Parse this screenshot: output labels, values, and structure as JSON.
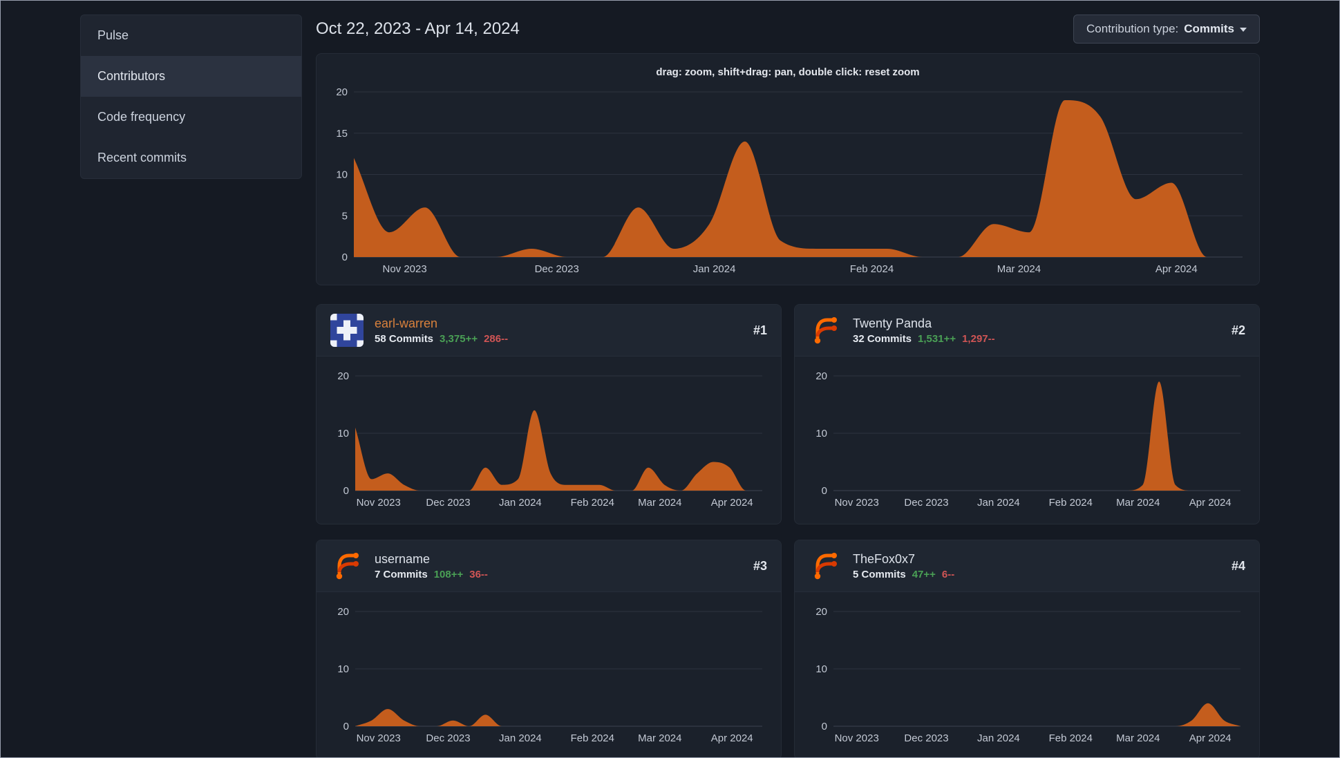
{
  "colors": {
    "accent_orange": "#c45d1d",
    "link_orange": "#d9813c",
    "additions_green": "#4aa055",
    "deletions_red": "#d05555",
    "gridline": "#2c333f",
    "axis_line": "#3c4452",
    "tick_text": "#c3c9d4"
  },
  "sidebar": {
    "items": [
      {
        "label": "Pulse",
        "active": false
      },
      {
        "label": "Contributors",
        "active": true
      },
      {
        "label": "Code frequency",
        "active": false
      },
      {
        "label": "Recent commits",
        "active": false
      }
    ]
  },
  "header": {
    "date_range": "Oct 22, 2023 - Apr 14, 2024"
  },
  "toolbar": {
    "contribution_type_label": "Contribution type:",
    "contribution_type_value": "Commits"
  },
  "axis": {
    "start_date": "Oct 22, 2023",
    "end_date": "Apr 14, 2024",
    "months": [
      {
        "label": "Nov 2023",
        "week": 1.43
      },
      {
        "label": "Dec 2023",
        "week": 5.71
      },
      {
        "label": "Jan 2024",
        "week": 10.14
      },
      {
        "label": "Feb 2024",
        "week": 14.57
      },
      {
        "label": "Mar 2024",
        "week": 18.71
      },
      {
        "label": "Apr 2024",
        "week": 23.14
      }
    ]
  },
  "main_chart": {
    "type": "area",
    "hint": "drag: zoom, shift+drag: pan, double click: reset zoom",
    "y_ticks": [
      0,
      5,
      10,
      15,
      20
    ],
    "ymax": 20,
    "ylim": [
      0,
      20
    ],
    "values": [
      12,
      3,
      6,
      0,
      0,
      1,
      0,
      0,
      6,
      1,
      4,
      14,
      2,
      1,
      1,
      1,
      0,
      0,
      4,
      3,
      19,
      17,
      7,
      9,
      0,
      0
    ]
  },
  "contributors": [
    {
      "rank": "#1",
      "name": "earl-warren",
      "commits_text": "58 Commits",
      "additions": "3,375++",
      "deletions": "286--",
      "avatar": "identicon",
      "linked": true,
      "chart": {
        "type": "area",
        "y_ticks": [
          0,
          10,
          20
        ],
        "ymax": 20,
        "ylim": [
          0,
          20
        ],
        "values": [
          11,
          2,
          3,
          1,
          0,
          0,
          0,
          0,
          4,
          1,
          2,
          14,
          3,
          1,
          1,
          1,
          0,
          0,
          4,
          1,
          0,
          3,
          5,
          4,
          0,
          0
        ]
      }
    },
    {
      "rank": "#2",
      "name": "Twenty Panda",
      "commits_text": "32 Commits",
      "additions": "1,531++",
      "deletions": "1,297--",
      "avatar": "forgejo",
      "linked": false,
      "chart": {
        "type": "area",
        "y_ticks": [
          0,
          10,
          20
        ],
        "ymax": 20,
        "ylim": [
          0,
          20
        ],
        "values": [
          0,
          0,
          0,
          0,
          0,
          0,
          0,
          0,
          0,
          0,
          0,
          0,
          0,
          0,
          0,
          0,
          0,
          0,
          0,
          1,
          19,
          1,
          0,
          0,
          0,
          0
        ]
      }
    },
    {
      "rank": "#3",
      "name": "username",
      "commits_text": "7 Commits",
      "additions": "108++",
      "deletions": "36--",
      "avatar": "forgejo",
      "linked": false,
      "chart": {
        "type": "area",
        "y_ticks": [
          0,
          10,
          20
        ],
        "ymax": 20,
        "ylim": [
          0,
          20
        ],
        "values": [
          0,
          1,
          3,
          1,
          0,
          0,
          1,
          0,
          2,
          0,
          0,
          0,
          0,
          0,
          0,
          0,
          0,
          0,
          0,
          0,
          0,
          0,
          0,
          0,
          0,
          0
        ]
      }
    },
    {
      "rank": "#4",
      "name": "TheFox0x7",
      "commits_text": "5 Commits",
      "additions": "47++",
      "deletions": "6--",
      "avatar": "forgejo",
      "linked": false,
      "chart": {
        "type": "area",
        "y_ticks": [
          0,
          10,
          20
        ],
        "ymax": 20,
        "ylim": [
          0,
          20
        ],
        "values": [
          0,
          0,
          0,
          0,
          0,
          0,
          0,
          0,
          0,
          0,
          0,
          0,
          0,
          0,
          0,
          0,
          0,
          0,
          0,
          0,
          0,
          0,
          1,
          4,
          1,
          0
        ]
      }
    }
  ]
}
